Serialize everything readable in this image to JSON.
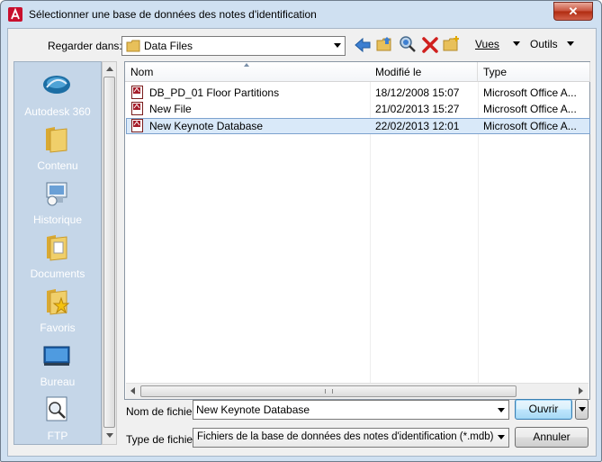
{
  "title": "Sélectionner une base de données des notes d'identification",
  "close_glyph": "✕",
  "lookin": {
    "label": "Regarder dans:",
    "value": "Data Files"
  },
  "toolbar": {
    "views": "Vues",
    "tools": "Outils"
  },
  "places": [
    {
      "label": "Autodesk 360",
      "icon": "autodesk-360-icon"
    },
    {
      "label": "Contenu",
      "icon": "folder-icon"
    },
    {
      "label": "Historique",
      "icon": "history-icon"
    },
    {
      "label": "Documents",
      "icon": "documents-icon"
    },
    {
      "label": "Favoris",
      "icon": "favorites-icon"
    },
    {
      "label": "Bureau",
      "icon": "desktop-icon"
    },
    {
      "label": "FTP",
      "icon": "ftp-icon"
    }
  ],
  "columns": {
    "name": "Nom",
    "modified": "Modifié le",
    "type": "Type"
  },
  "files": [
    {
      "name": "DB_PD_01 Floor Partitions",
      "modified": "18/12/2008 15:07",
      "type": "Microsoft Office A..."
    },
    {
      "name": "New File",
      "modified": "21/02/2013 15:27",
      "type": "Microsoft Office A..."
    },
    {
      "name": "New Keynote Database",
      "modified": "22/02/2013 12:01",
      "type": "Microsoft Office A..."
    }
  ],
  "selected_index": 2,
  "filename": {
    "label": "Nom de fichier:",
    "value": "New Keynote Database"
  },
  "filetype": {
    "label": "Type de fichier:",
    "value": "Fichiers de la base de données des notes d'identification (*.mdb)"
  },
  "buttons": {
    "open": "Ouvrir",
    "cancel": "Annuler"
  },
  "colors": {
    "accent_red": "#c8102e",
    "selection": "#d9e9f9",
    "places_bg": "#c5d6e8"
  }
}
